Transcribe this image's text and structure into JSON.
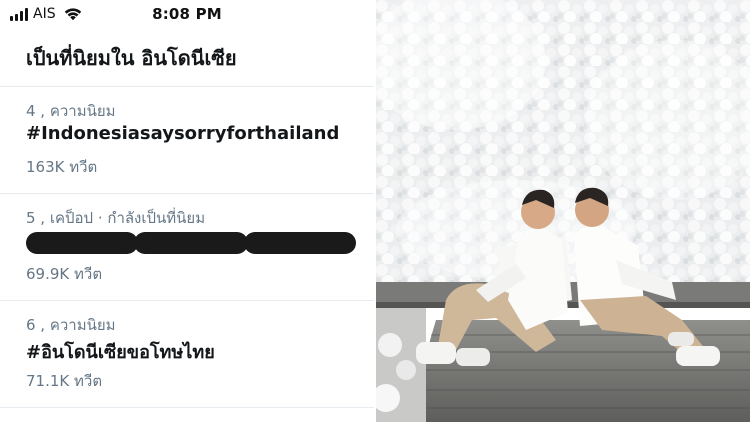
{
  "status_bar": {
    "carrier": "AIS",
    "time": "8:08 PM",
    "icons": [
      "signal-icon",
      "wifi-icon"
    ]
  },
  "header": {
    "title": "เป็นที่นิยมใน อินโดนีเซีย"
  },
  "trends": [
    {
      "meta": "4 , ความนิยม",
      "name": "#Indonesiasaysorryforthailand",
      "count": "163K ทวีต"
    },
    {
      "meta": "5 , เคป็อป · กำลังเป็นที่นิยม",
      "name": "",
      "name_redacted": true,
      "count": "69.9K ทวีต"
    },
    {
      "meta": "6 , ความนิยม",
      "name": "#อินโดนีเซียขอโทษไทย",
      "count": "71.1K ทวีต"
    }
  ],
  "colors": {
    "text_primary": "#14171a",
    "text_secondary": "#657786",
    "divider": "#e6ecf0",
    "redaction": "#1a1a1a"
  }
}
